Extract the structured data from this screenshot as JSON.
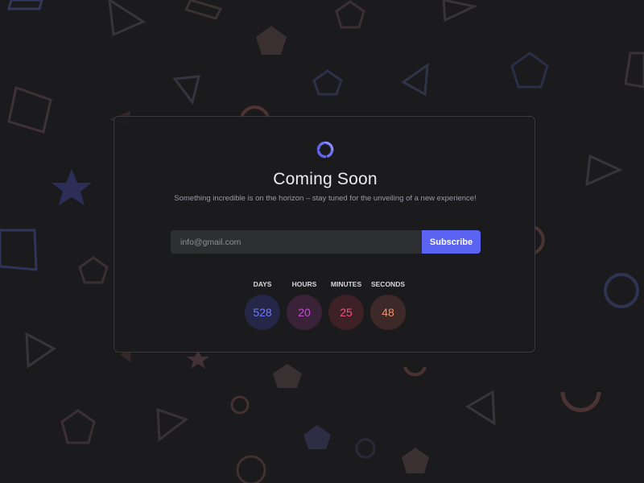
{
  "colors": {
    "background": "#1b1b1d",
    "card_border": "#3a3a40",
    "accent": "#5b63f2",
    "days": "#6d73f7",
    "hours": "#c14ad1",
    "minutes": "#ef4f89",
    "seconds": "#f48c63"
  },
  "icons": {
    "brand": "spinner-logo-icon"
  },
  "page": {
    "title": "Coming Soon",
    "subtitle": "Something incredible is on the horizon – stay tuned for the unveiling of a new experience!"
  },
  "newsletter": {
    "email_placeholder": "info@gmail.com",
    "email_value": "",
    "subscribe_label": "Subscribe"
  },
  "countdown": {
    "days_label": "DAYS",
    "days_value": "528",
    "hours_label": "HOURS",
    "hours_value": "20",
    "minutes_label": "MINUTES",
    "minutes_value": "25",
    "seconds_label": "SECONDS",
    "seconds_value": "48"
  }
}
